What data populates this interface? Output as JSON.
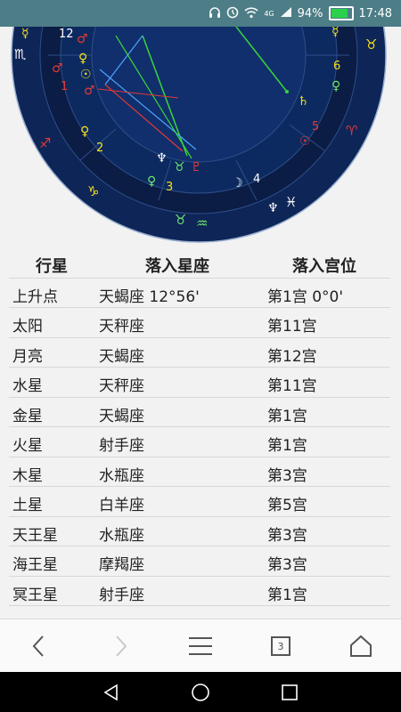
{
  "status_bar": {
    "signal_label": "4G",
    "battery_percent": "94%",
    "battery_level": 0.94,
    "time": "17:48"
  },
  "chart": {
    "house_numbers": [
      "12",
      "1",
      "2",
      "3",
      "4",
      "5",
      "6"
    ],
    "colors": {
      "wheel": "#0f2a5e",
      "ring": "#0a1d45",
      "line_green": "#3bd33b",
      "line_red": "#e53935",
      "line_blue": "#4da3ff",
      "glyph_yellow": "#f5e11a",
      "glyph_red": "#ff3b3b",
      "glyph_green": "#6ee66e",
      "glyph_white": "#ffffff"
    }
  },
  "table": {
    "headers": [
      "行星",
      "落入星座",
      "落入宫位"
    ],
    "rows": [
      [
        "上升点",
        "天蝎座 12°56'",
        "第1宫 0°0'"
      ],
      [
        "太阳",
        "天秤座",
        "第11宫"
      ],
      [
        "月亮",
        "天蝎座",
        "第12宫"
      ],
      [
        "水星",
        "天秤座",
        "第11宫"
      ],
      [
        "金星",
        "天蝎座",
        "第1宫"
      ],
      [
        "火星",
        "射手座",
        "第1宫"
      ],
      [
        "木星",
        "水瓶座",
        "第3宫"
      ],
      [
        "土星",
        "白羊座",
        "第5宫"
      ],
      [
        "天王星",
        "水瓶座",
        "第3宫"
      ],
      [
        "海王星",
        "摩羯座",
        "第3宫"
      ],
      [
        "冥王星",
        "射手座",
        "第1宫"
      ]
    ]
  },
  "browser_nav": {
    "tab_count": "3"
  }
}
